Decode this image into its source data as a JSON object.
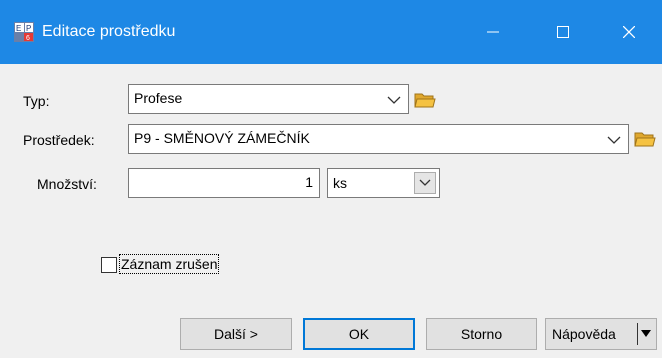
{
  "window": {
    "title": "Editace prostředku",
    "icon": "app-ep-icon"
  },
  "form": {
    "typ": {
      "label": "Typ:",
      "value": "Profese"
    },
    "prostredek": {
      "label": "Prostředek:",
      "value": "P9 - SMĚNOVÝ ZÁMEČNÍK"
    },
    "mnozstvi": {
      "label": "Množství:",
      "value": "1",
      "unit": "ks"
    },
    "zaznam_zrusen": {
      "label": "Záznam zrušen",
      "checked": false
    }
  },
  "buttons": {
    "next": "Další >",
    "ok": "OK",
    "cancel": "Storno",
    "help": "Nápověda"
  },
  "colors": {
    "titlebar": "#1e88e5",
    "background": "#f0f0f0",
    "ok_border": "#0078d7",
    "folder": "#f5c242"
  }
}
